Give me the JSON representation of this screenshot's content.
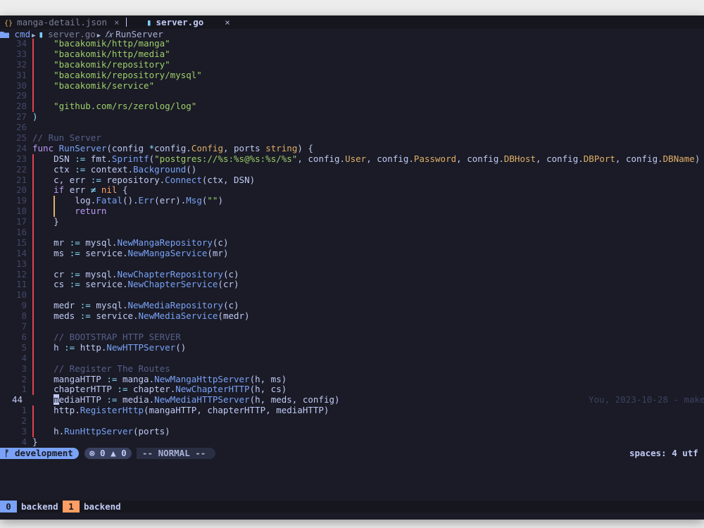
{
  "tabs": [
    {
      "label": "manga-detail.json",
      "icon": "{}",
      "close": "×",
      "active": false
    },
    {
      "label": "server.go",
      "icon": "▮",
      "close": "×",
      "active": true
    }
  ],
  "breadcrumb": {
    "folder": "cmd",
    "sep": "▶",
    "file": "server.go",
    "fx": "𝑓𝑥",
    "func": "RunServer"
  },
  "code_lines": [
    {
      "ln": "34",
      "html": "    <span class='str'>\"bacakomik/http/manga\"</span>",
      "guides": [
        "red"
      ]
    },
    {
      "ln": "33",
      "html": "    <span class='str'>\"bacakomik/http/media\"</span>",
      "guides": [
        "red"
      ]
    },
    {
      "ln": "32",
      "html": "    <span class='str'>\"bacakomik/repository\"</span>",
      "guides": [
        "red"
      ]
    },
    {
      "ln": "31",
      "html": "    <span class='str'>\"bacakomik/repository/mysql\"</span>",
      "guides": [
        "red"
      ]
    },
    {
      "ln": "30",
      "html": "    <span class='str'>\"bacakomik/service\"</span>",
      "guides": [
        "red"
      ]
    },
    {
      "ln": "29",
      "html": "",
      "guides": [
        "red"
      ]
    },
    {
      "ln": "28",
      "html": "    <span class='str'>\"github.com/rs/zerolog/log\"</span>",
      "guides": [
        "red"
      ]
    },
    {
      "ln": "27",
      "html": "<span class='op'>)</span>",
      "guides": []
    },
    {
      "ln": "26",
      "html": "",
      "guides": []
    },
    {
      "ln": "25",
      "html": "<span class='cm'>// Run Server</span>",
      "guides": []
    },
    {
      "ln": "24",
      "html": "<span class='kw'>func</span> <span class='fn'>RunServer</span>(config <span class='op'>*</span>config.<span class='ty'>Config</span>, ports <span class='ty'>string</span>) {",
      "guides": []
    },
    {
      "ln": "23",
      "html": "    DSN <span class='op'>:=</span> fmt.<span class='fn'>Sprintf</span>(<span class='str'>\"postgres://%s:%s@%s:%s/%s\"</span>, config.<span class='ty'>User</span>, config.<span class='ty'>Password</span>, config.<span class='ty'>DBHost</span>, config.<span class='ty'>DBPort</span>, config.<span class='ty'>DBName</span>)",
      "guides": [
        "red"
      ]
    },
    {
      "ln": "22",
      "html": "    ctx <span class='op'>:=</span> context.<span class='fn'>Background</span>()",
      "guides": [
        "red"
      ]
    },
    {
      "ln": "21",
      "html": "    c, err <span class='op'>:=</span> repository.<span class='fn'>Connect</span>(ctx, DSN)",
      "guides": [
        "red"
      ]
    },
    {
      "ln": "20",
      "html": "    <span class='kw'>if</span> err <span class='op'>≠</span> <span class='nil'>nil</span> {",
      "guides": [
        "red"
      ]
    },
    {
      "ln": "19",
      "html": "        log.<span class='fn'>Fatal</span>().<span class='fn'>Err</span>(err).<span class='fn'>Msg</span>(<span class='str'>\"\"</span>)",
      "guides": [
        "red",
        "yellow"
      ]
    },
    {
      "ln": "18",
      "html": "        <span class='kw'>return</span>",
      "guides": [
        "red",
        "yellow"
      ]
    },
    {
      "ln": "17",
      "html": "    }",
      "guides": [
        "red"
      ]
    },
    {
      "ln": "16",
      "html": "",
      "guides": [
        "red"
      ]
    },
    {
      "ln": "15",
      "html": "    mr <span class='op'>:=</span> mysql.<span class='fn'>NewMangaRepository</span>(c)",
      "guides": [
        "red"
      ]
    },
    {
      "ln": "14",
      "html": "    ms <span class='op'>:=</span> service.<span class='fn'>NewMangaService</span>(mr)",
      "guides": [
        "red"
      ]
    },
    {
      "ln": "13",
      "html": "",
      "guides": [
        "red"
      ]
    },
    {
      "ln": "12",
      "html": "    cr <span class='op'>:=</span> mysql.<span class='fn'>NewChapterRepository</span>(c)",
      "guides": [
        "red"
      ]
    },
    {
      "ln": "11",
      "html": "    cs <span class='op'>:=</span> service.<span class='fn'>NewChapterService</span>(cr)",
      "guides": [
        "red"
      ]
    },
    {
      "ln": "10",
      "html": "",
      "guides": [
        "red"
      ]
    },
    {
      "ln": "9",
      "html": "    medr <span class='op'>:=</span> mysql.<span class='fn'>NewMediaRepository</span>(c)",
      "guides": [
        "red"
      ]
    },
    {
      "ln": "8",
      "html": "    meds <span class='op'>:=</span> service.<span class='fn'>NewMediaService</span>(medr)",
      "guides": [
        "red"
      ]
    },
    {
      "ln": "7",
      "html": "",
      "guides": [
        "red"
      ]
    },
    {
      "ln": "6",
      "html": "    <span class='cm'>// BOOTSTRAP HTTP SERVER</span>",
      "guides": [
        "red"
      ]
    },
    {
      "ln": "5",
      "html": "    h <span class='op'>:=</span> http.<span class='fn'>NewHTTPServer</span>()",
      "guides": [
        "red"
      ]
    },
    {
      "ln": "4",
      "html": "",
      "guides": [
        "red"
      ]
    },
    {
      "ln": "3",
      "html": "    <span class='cm'>// Register The Routes</span>",
      "guides": [
        "red"
      ]
    },
    {
      "ln": "2",
      "html": "    mangaHTTP <span class='op'>:=</span> manga.<span class='fn'>NewMangaHttpServer</span>(h, ms)",
      "guides": [
        "red"
      ]
    },
    {
      "ln": "1",
      "html": "    chapterHTTP <span class='op'>:=</span> chapter.<span class='fn'>NewChapterHTTP</span>(h, cs)",
      "guides": [
        "red"
      ]
    },
    {
      "ln": "44",
      "html": "    <span class='cursor'>m</span>ediaHTTP <span class='op'>:=</span> media.<span class='fn'>NewMediaHTTPServer</span>(h, meds, config)",
      "guides": [],
      "current": true,
      "blame": "You, 2023-10-28 - make"
    },
    {
      "ln": "1",
      "html": "    http.<span class='fn'>RegisterHttp</span>(mangaHTTP, chapterHTTP, mediaHTTP)",
      "guides": [
        "red"
      ]
    },
    {
      "ln": "2",
      "html": "",
      "guides": [
        "red"
      ]
    },
    {
      "ln": "3",
      "html": "    h.<span class='fn'>RunHttpServer</span>(ports)",
      "guides": [
        "red"
      ]
    },
    {
      "ln": "4",
      "html": "}",
      "guides": []
    }
  ],
  "statusline": {
    "branch": "ᚠ development",
    "errors": "⊗ 0",
    "warnings": "▲ 0",
    "mode": "-- NORMAL --",
    "right": "spaces: 4  utf"
  },
  "tmux": {
    "windows": [
      {
        "index": "0",
        "name": "backend"
      },
      {
        "index": "1",
        "name": "backend"
      }
    ]
  },
  "colors": {
    "bg": "#1a1b26",
    "keyword": "#bb9af7",
    "string": "#9ece6a",
    "function": "#7aa2f7",
    "type": "#e0af68",
    "comment": "#565f89",
    "accent": "#7aa2f7"
  }
}
